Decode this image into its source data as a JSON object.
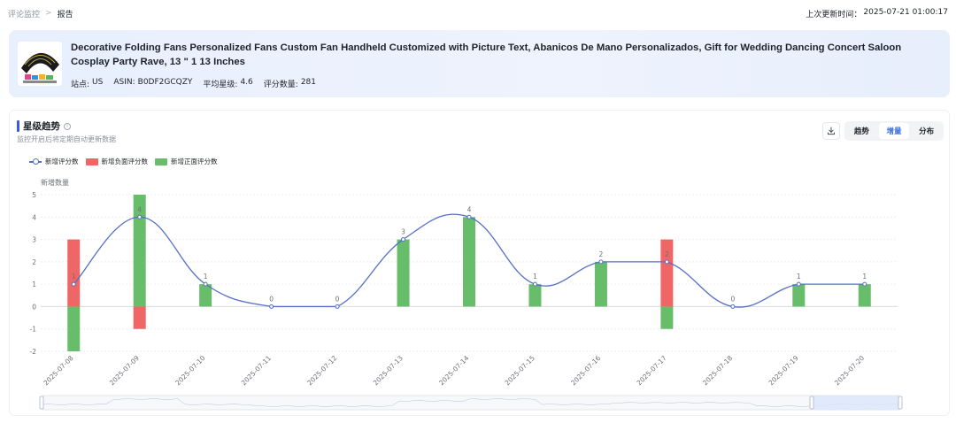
{
  "breadcrumb": {
    "parent": "评论监控",
    "separator": ">",
    "current": "报告"
  },
  "last_updated": {
    "label": "上次更新时间：",
    "value": "2025-07-21 01:00:17"
  },
  "product": {
    "title": "Decorative Folding Fans Personalized Fans Custom Fan Handheld Customized with Picture Text, Abanicos De Mano Personalizados, Gift for Wedding Dancing Concert Saloon Cosplay Party Rave, 13 \" 1 13 Inches",
    "site_label": "站点:",
    "site": "US",
    "asin_label": "ASIN:",
    "asin": "B0DF2GCQZY",
    "rating_label": "平均星级:",
    "rating": "4.6",
    "reviews_label": "评分数量:",
    "reviews": "281"
  },
  "panel": {
    "title": "星级趋势",
    "info_icon": "info-circle-icon",
    "subtitle": "监控开启后将定期自动更新数据",
    "download_icon": "download-icon",
    "tabs": [
      {
        "label": "趋势",
        "active": false
      },
      {
        "label": "增量",
        "active": true
      },
      {
        "label": "分布",
        "active": false
      }
    ]
  },
  "colors": {
    "line": "#5470c6",
    "negative": "#ee6666",
    "positive": "#67bd6a",
    "accent": "#3b6fe6"
  },
  "chart_data": {
    "type": "bar",
    "ylabel": "新增数量",
    "ylim": [
      -2,
      5
    ],
    "yticks": [
      -2,
      -1,
      0,
      1,
      2,
      3,
      4,
      5
    ],
    "legend_position": "top-left",
    "grid": true,
    "categories": [
      "2025-07-08",
      "2025-07-09",
      "2025-07-10",
      "2025-07-11",
      "2025-07-12",
      "2025-07-13",
      "2025-07-14",
      "2025-07-15",
      "2025-07-16",
      "2025-07-17",
      "2025-07-18",
      "2025-07-19",
      "2025-07-20"
    ],
    "series": [
      {
        "name": "新增评分数",
        "type": "line",
        "smooth": true,
        "values": [
          1,
          4,
          1,
          0,
          0,
          3,
          4,
          1,
          2,
          2,
          0,
          1,
          1
        ]
      },
      {
        "name": "新增负面评分数",
        "type": "bar",
        "values": [
          3,
          -1,
          0,
          0,
          0,
          0,
          0,
          0,
          0,
          3,
          0,
          0,
          0
        ]
      },
      {
        "name": "新增正面评分数",
        "type": "bar",
        "values": [
          -2,
          5,
          1,
          0,
          0,
          3,
          4,
          1,
          2,
          -1,
          0,
          1,
          1
        ]
      }
    ],
    "datazoom": {
      "start": 0,
      "end": 1
    }
  }
}
